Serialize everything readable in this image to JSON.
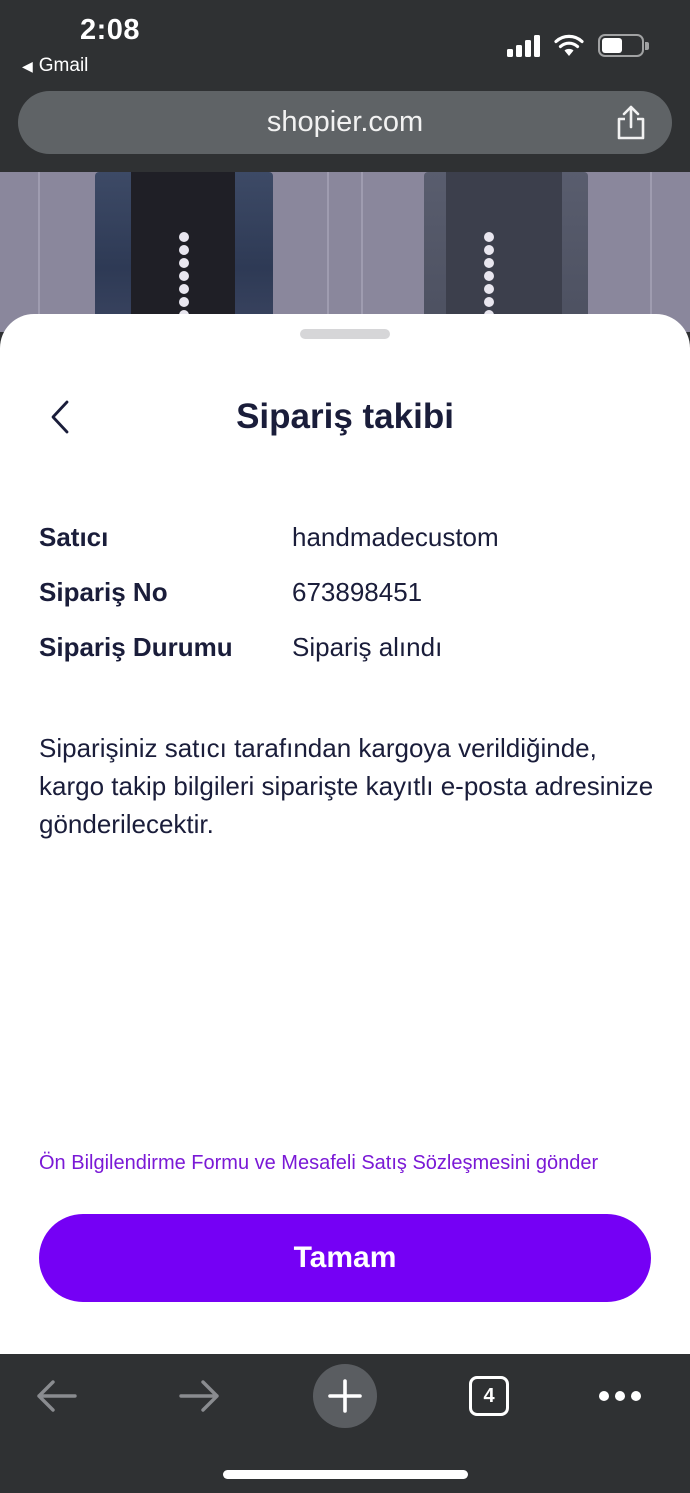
{
  "status_bar": {
    "time": "2:08",
    "back_app": "Gmail",
    "back_arrow": "◀"
  },
  "browser": {
    "url": "shopier.com",
    "open_tabs": "4"
  },
  "sheet": {
    "title": "Sipariş takibi",
    "rows": [
      {
        "label": "Satıcı",
        "value": "handmadecustom"
      },
      {
        "label": "Sipariş No",
        "value": "673898451"
      },
      {
        "label": "Sipariş Durumu",
        "value": "Sipariş alındı"
      }
    ],
    "message": "Siparişiniz satıcı tarafından kargoya verildiğinde, kargo takip bilgileri siparişte kayıtlı e-posta adresinize gönderilecektir.",
    "contract_link": "Ön Bilgilendirme Formu ve Mesafeli Satış Sözleşmesini gönder",
    "ok_button": "Tamam"
  },
  "colors": {
    "accent": "#7500f5",
    "link": "#7a19d6",
    "text": "#1a1d3a",
    "chrome": "#2f3133"
  },
  "icons": {
    "sheet_back": "chevron-left-icon",
    "share": "share-icon",
    "toolbar_back": "arrow-left-icon",
    "toolbar_forward": "arrow-right-icon",
    "new_tab": "plus-icon",
    "more": "more-horizontal-icon"
  }
}
